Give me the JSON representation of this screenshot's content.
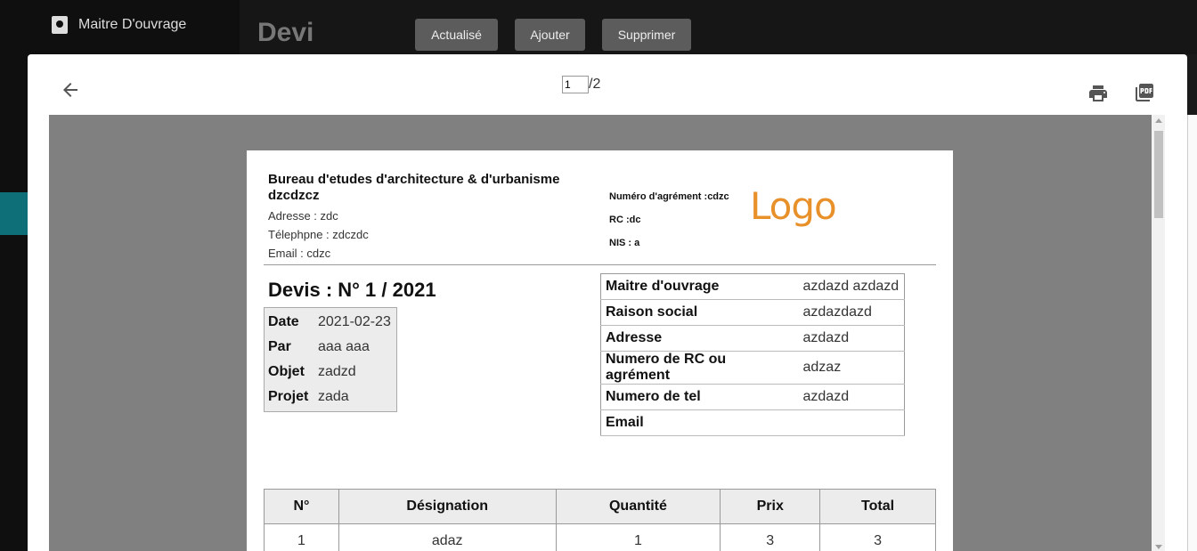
{
  "background": {
    "user_label": "Maitre D'ouvrage",
    "page_title": "Devi",
    "buttons": {
      "refresh": "Actualisé",
      "add": "Ajouter",
      "delete": "Supprimer"
    }
  },
  "viewer": {
    "current_page": "1",
    "total_pages": "/2"
  },
  "document": {
    "org_name": "Bureau d'etudes d'architecture & d'urbanisme dzcdzcz",
    "address": "Adresse : zdc",
    "phone": "Télephpne : zdczdc",
    "email": "Email : cdzc",
    "agrement": "Numéro d'agrément :cdzc",
    "rc": "RC :dc",
    "nis": "NIS : a",
    "logo_text": "Logo",
    "title": "Devis : N° 1 / 2021",
    "meta": [
      {
        "k": "Date",
        "v": "2021-02-23"
      },
      {
        "k": "Par",
        "v": "aaa aaa"
      },
      {
        "k": "Objet",
        "v": "zadzd"
      },
      {
        "k": "Projet",
        "v": "zada"
      }
    ],
    "client": [
      {
        "k": "Maitre d'ouvrage",
        "v": "azdazd azdazd"
      },
      {
        "k": "Raison social",
        "v": "azdazdazd"
      },
      {
        "k": "Adresse",
        "v": "azdazd"
      },
      {
        "k": "Numero de RC ou agrément",
        "v": "adzaz"
      },
      {
        "k": "Numero de tel",
        "v": "azdazd"
      },
      {
        "k": "Email",
        "v": ""
      }
    ],
    "items_headers": [
      "N°",
      "Désignation",
      "Quantité",
      "Prix",
      "Total"
    ],
    "items": [
      [
        "1",
        "adaz",
        "1",
        "3",
        "3"
      ]
    ]
  },
  "colors": {
    "logo": "#e8902a",
    "teal_accent": "#0f6f78",
    "viewer_bg": "#808080"
  }
}
